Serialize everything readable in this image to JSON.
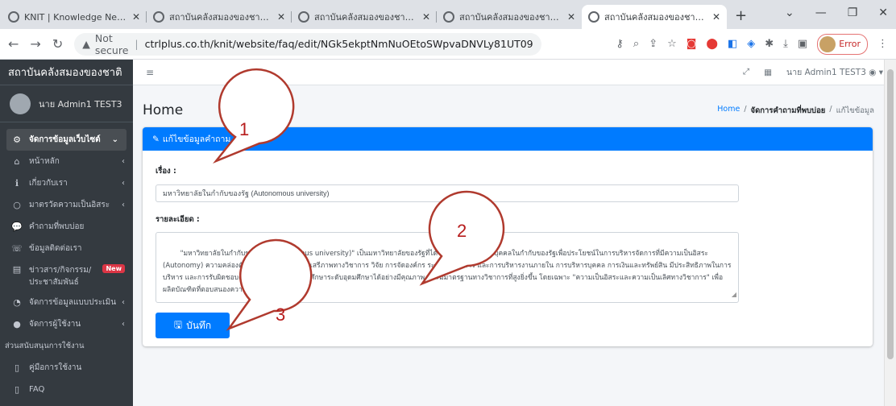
{
  "browser": {
    "tabs": [
      {
        "title": "KNIT | Knowledge Network In",
        "active": false
      },
      {
        "title": "สถาบันคลังสมองของชาติ PHP Cl",
        "active": false
      },
      {
        "title": "สถาบันคลังสมองของชาติ PHP Cl",
        "active": false
      },
      {
        "title": "สถาบันคลังสมองของชาติ PHP Cl",
        "active": false
      },
      {
        "title": "สถาบันคลังสมองของชาติ PHP Cl",
        "active": true
      }
    ],
    "new_tab": "+",
    "security_label": "Not secure",
    "url": "ctrlplus.co.th/knit/website/faq/edit/NGk5ekptNmNuOEtoSWpvaDNVLy81UT09",
    "profile_status": "Error"
  },
  "sidebar": {
    "brand": "สถาบันคลังสมองของชาติ",
    "user_name": "นาย Admin1 TEST3",
    "items": [
      {
        "label": "จัดการข้อมูลเว็บไซต์",
        "icon": "cogs-icon",
        "glyph": "⚙",
        "arrow": "⌄",
        "active": true
      },
      {
        "label": "หน้าหลัก",
        "icon": "home-icon",
        "glyph": "⌂",
        "arrow": "‹"
      },
      {
        "label": "เกี่ยวกับเรา",
        "icon": "info-icon",
        "glyph": "ℹ",
        "arrow": "‹"
      },
      {
        "label": "มาตรวัดความเป็นอิสระ",
        "icon": "circle-icon",
        "glyph": "○",
        "arrow": "‹"
      },
      {
        "label": "คำถามที่พบบ่อย",
        "icon": "comments-icon",
        "glyph": "💬",
        "arrow": ""
      },
      {
        "label": "ข้อมูลติดต่อเรา",
        "icon": "phone-icon",
        "glyph": "☏",
        "arrow": ""
      },
      {
        "label": "ข่าวสาร/กิจกรรม/ ประชาสัมพันธ์",
        "icon": "newspaper-icon",
        "glyph": "▤",
        "badge": "New"
      },
      {
        "label": "จัดการข้อมูลแบบประเมิน",
        "icon": "dashboard-icon",
        "glyph": "◔",
        "arrow": "‹"
      },
      {
        "label": "จัดการผู้ใช้งาน",
        "icon": "user-icon",
        "glyph": "●",
        "arrow": "‹"
      }
    ],
    "section_header": "ส่วนสนับสนุนการใช้งาน",
    "support_items": [
      {
        "label": "คู่มือการใช้งาน",
        "icon": "file-icon",
        "glyph": "▯"
      },
      {
        "label": "FAQ",
        "icon": "file-icon",
        "glyph": "▯"
      }
    ]
  },
  "topnav": {
    "menu_icon": "≡",
    "user_label": "นาย Admin1 TEST3"
  },
  "page": {
    "title": "Home",
    "breadcrumb": {
      "home": "Home",
      "section": "จัดการคำถามที่พบบ่อย",
      "current": "แก้ไขข้อมูล"
    },
    "card_title": "แก้ไขข้อมูลคำถาม",
    "subject_label": "เรื่อง :",
    "subject_value": "มหาวิทยาลัยในกำกับของรัฐ (Autonomous university)",
    "detail_label": "รายละเอียด :",
    "detail_value": "\"มหาวิทยาลัยในกำกับของรัฐ (Autonomous university)\" เป็นมหาวิทยาลัยของรัฐที่ได้รับการจัดตั้งเป็นนิติบุคคลในกำกับของรัฐเพื่อประโยชน์ในการบริหารจัดการที่มีความเป็นอิสระ (Autonomy) ความคล่องตัว (Flexibility) ในด้านเสรีภาพทางวิชาการ วิจัย การจัดองค์กร ระบบการบริหาร และการบริหารงานภายใน การบริหารบุคคล การเงินและทรัพย์สิน มีประสิทธิภาพในการบริหาร และการรับผิดชอบต่อสังคม สามารถจัดการศึกษาระดับอุดมศึกษาได้อย่างมีคุณภาพ และมีมาตรฐานทางวิชาการที่สูงยิ่งขึ้น โดยเฉพาะ \"ความเป็นอิสระและความเป็นเลิศทางวิชาการ\" เพื่อผลิตบัณฑิตที่ตอบสนองความต้องการของประเทศ",
    "save_label": "บันทึก"
  },
  "callouts": [
    "1",
    "2",
    "3"
  ],
  "colors": {
    "primary": "#007bff",
    "sidebar": "#343a40",
    "callout": "#b03a2e"
  }
}
